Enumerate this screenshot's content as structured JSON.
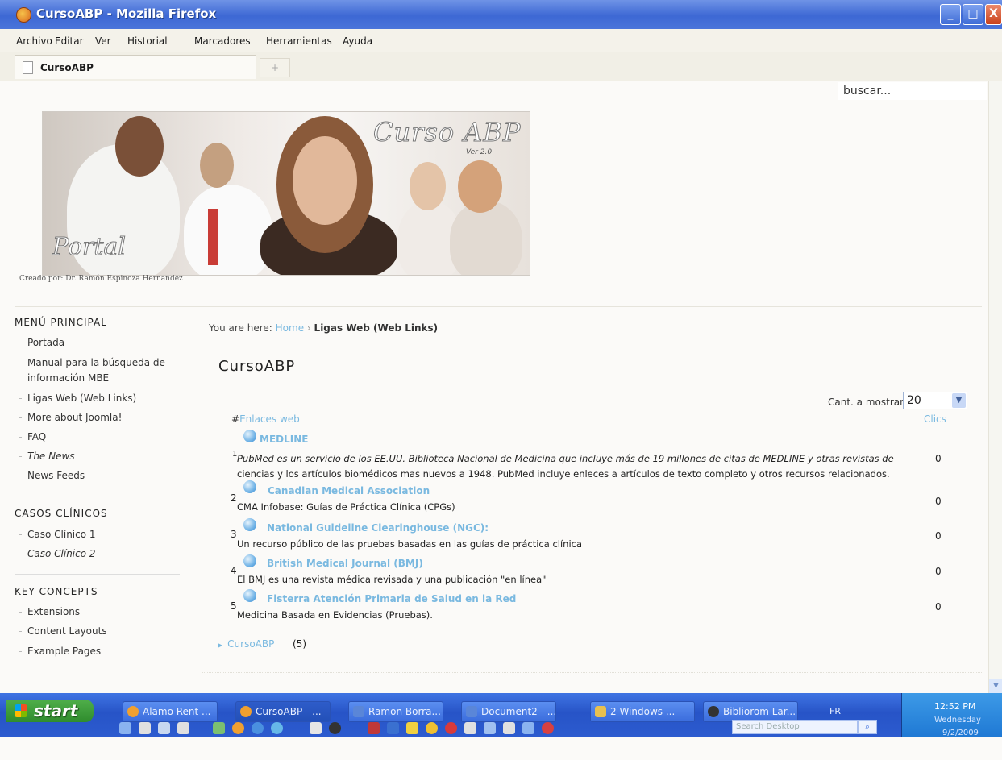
{
  "window": {
    "title": "CursoABP - Mozilla Firefox",
    "buttons": {
      "minimize": "_",
      "maximize": "□",
      "close": "X"
    }
  },
  "menu": [
    "Archivo",
    "Editar",
    "Ver",
    "Historial",
    "Marcadores",
    "Herramientas",
    "Ayuda"
  ],
  "tab": {
    "label": "CursoABP",
    "new_tab": "+"
  },
  "search": {
    "value": "buscar..."
  },
  "banner": {
    "title": "Curso ABP",
    "version": "Ver 2.0",
    "portal": "Portal",
    "credit": "Creado por: Dr. Ramón Espinoza Hernandez"
  },
  "sidebar": {
    "menu_principal": {
      "heading": "MENÚ PRINCIPAL",
      "items": [
        "Portada",
        "Manual para la búsqueda de información MBE",
        "Ligas Web (Web Links)",
        "More about Joomla!",
        "FAQ",
        "The News",
        "News Feeds"
      ]
    },
    "casos": {
      "heading": "CASOS CLÍNICOS",
      "items": [
        "Caso Clínico 1",
        "Caso Clínico 2"
      ]
    },
    "key": {
      "heading": "KEY CONCEPTS",
      "items": [
        "Extensions",
        "Content Layouts",
        "Example Pages"
      ]
    }
  },
  "breadcrumb": {
    "prefix": "You are here:",
    "home": "Home",
    "separator": "›",
    "current": "Ligas Web (Web Links)"
  },
  "page": {
    "title": "CursoABP",
    "display_label": "Cant. a mostrar",
    "display_value": "20",
    "col_hash": "#",
    "col_links": "Enlaces web",
    "col_clics": "Clics",
    "links": [
      {
        "num": "1",
        "title": "MEDLINE",
        "desc": "PubMed es un servicio de los EE.UU. Biblioteca Nacional de Medicina que incluye más de 19 millones de citas de MEDLINE y otras revistas de",
        "desc2": "ciencias y los artículos biomédicos mas nuevos a 1948. PubMed incluye enleces a artículos de texto completo y otros recursos relacionados.",
        "clics": "0"
      },
      {
        "num": "2",
        "title": "Canadian Medical Association",
        "desc": "CMA Infobase: Guías de Práctica Clínica (CPGs)",
        "clics": "0"
      },
      {
        "num": "3",
        "title": "National Guideline Clearinghouse (NGC):",
        "desc": "Un recurso público de las pruebas basadas en las guías de práctica clínica",
        "clics": "0"
      },
      {
        "num": "4",
        "title": "British Medical Journal (BMJ)",
        "desc": "El BMJ es una revista médica revisada y una publicación \"en línea\"",
        "clics": "0"
      },
      {
        "num": "5",
        "title": "Fisterra Atención Primaria de Salud en la Red",
        "desc": "Medicina Basada en Evidencias (Pruebas).",
        "clics": "0"
      }
    ],
    "category": {
      "label": "CursoABP",
      "count": "(5)"
    }
  },
  "taskbar": {
    "start": "start",
    "tasks": [
      "Alamo Rent ...",
      "CursoABP - ...",
      "Ramon Borra...",
      "Document2 - ...",
      "2 Windows ...",
      "Bibliorom Lar..."
    ],
    "lang": "FR",
    "search_placeholder": "Search Desktop",
    "time": "12:52 PM",
    "day": "Wednesday",
    "date": "9/2/2009"
  },
  "colors": {
    "link": "#7ab9e0",
    "titlebar": "#3d68d4",
    "start": "#2f8c2d"
  }
}
